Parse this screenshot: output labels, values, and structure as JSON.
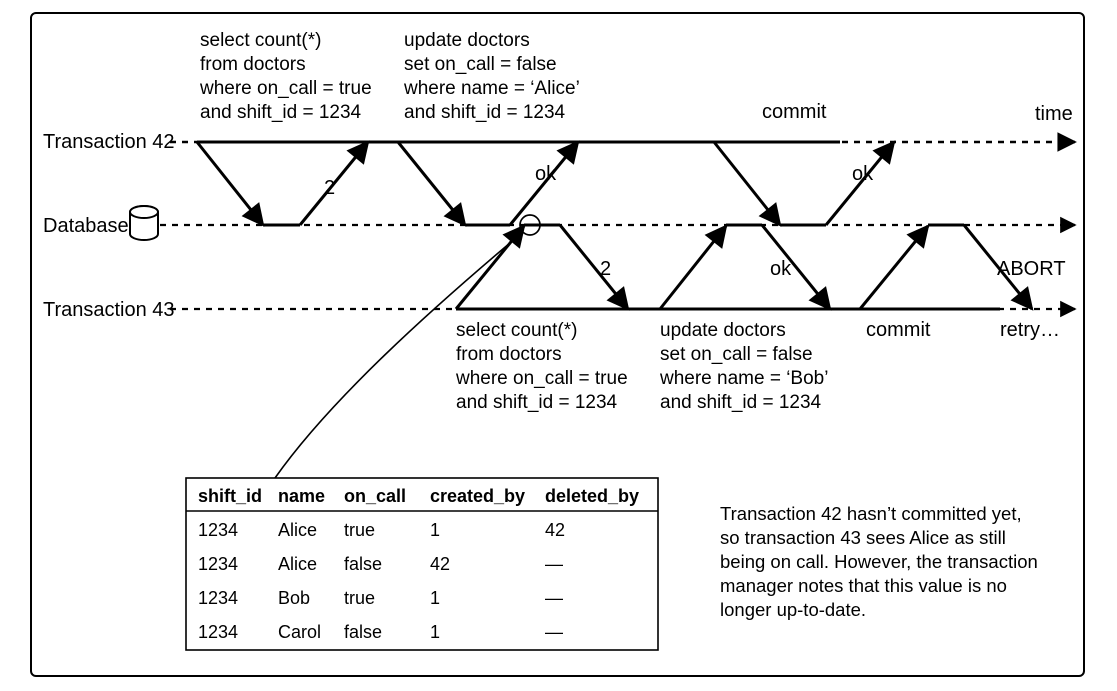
{
  "chart_data": {
    "type": "sequence-diagram",
    "lanes": [
      "Transaction 42",
      "Database",
      "Transaction 43"
    ],
    "events": [
      {
        "from": "Transaction 42",
        "to": "Database",
        "request": "select count(*) from doctors where on_call = true and shift_id = 1234",
        "response": "2"
      },
      {
        "from": "Transaction 42",
        "to": "Database",
        "request": "update doctors set on_call = false where name = 'Alice' and shift_id = 1234",
        "response": "ok"
      },
      {
        "from": "Transaction 43",
        "to": "Database",
        "request": "select count(*) from doctors where on_call = true and shift_id = 1234",
        "response": "2"
      },
      {
        "from": "Transaction 43",
        "to": "Database",
        "request": "update doctors set on_call = false where name = 'Bob' and shift_id = 1234",
        "response": "ok"
      },
      {
        "from": "Transaction 42",
        "to": "Database",
        "request": "commit",
        "response": "ok"
      },
      {
        "from": "Transaction 43",
        "to": "Database",
        "request": "commit",
        "response": "ABORT"
      },
      {
        "lane": "Transaction 43",
        "label": "retry…"
      }
    ]
  },
  "labels": {
    "t42": "Transaction 42",
    "db": "Database",
    "t43": "Transaction 43",
    "time": "time",
    "commit_t42": "commit",
    "commit_t43": "commit",
    "retry": "retry…",
    "r_two_a": "2",
    "r_ok_a": "ok",
    "r_two_b": "2",
    "r_ok_b": "ok",
    "r_ok_c": "ok",
    "r_abort": "ABORT"
  },
  "sql": {
    "t42_q1_l1": "select count(*)",
    "t42_q1_l2": "from doctors",
    "t42_q1_l3": "where on_call = true",
    "t42_q1_l4": "and shift_id = 1234",
    "t42_q2_l1": "update doctors",
    "t42_q2_l2": "set on_call = false",
    "t42_q2_l3": "where name = ‘Alice’",
    "t42_q2_l4": "and shift_id = 1234",
    "t43_q1_l1": "select count(*)",
    "t43_q1_l2": "from doctors",
    "t43_q1_l3": "where on_call = true",
    "t43_q1_l4": "and shift_id = 1234",
    "t43_q2_l1": "update doctors",
    "t43_q2_l2": "set on_call = false",
    "t43_q2_l3": "where name = ‘Bob’",
    "t43_q2_l4": "and shift_id = 1234"
  },
  "table": {
    "headers": {
      "c1": "shift_id",
      "c2": "name",
      "c3": "on_call",
      "c4": "created_by",
      "c5": "deleted_by"
    },
    "rows": [
      {
        "c1": "1234",
        "c2": "Alice",
        "c3": "true",
        "c4": "1",
        "c5": "42"
      },
      {
        "c1": "1234",
        "c2": "Alice",
        "c3": "false",
        "c4": "42",
        "c5": "—"
      },
      {
        "c1": "1234",
        "c2": "Bob",
        "c3": "true",
        "c4": "1",
        "c5": "—"
      },
      {
        "c1": "1234",
        "c2": "Carol",
        "c3": "false",
        "c4": "1",
        "c5": "—"
      }
    ]
  },
  "note": {
    "l1": "Transaction 42 hasn’t committed yet,",
    "l2": "so transaction 43 sees Alice as still",
    "l3": "being on call. However, the transaction",
    "l4": "manager notes that this value is no",
    "l5": "longer up-to-date."
  }
}
